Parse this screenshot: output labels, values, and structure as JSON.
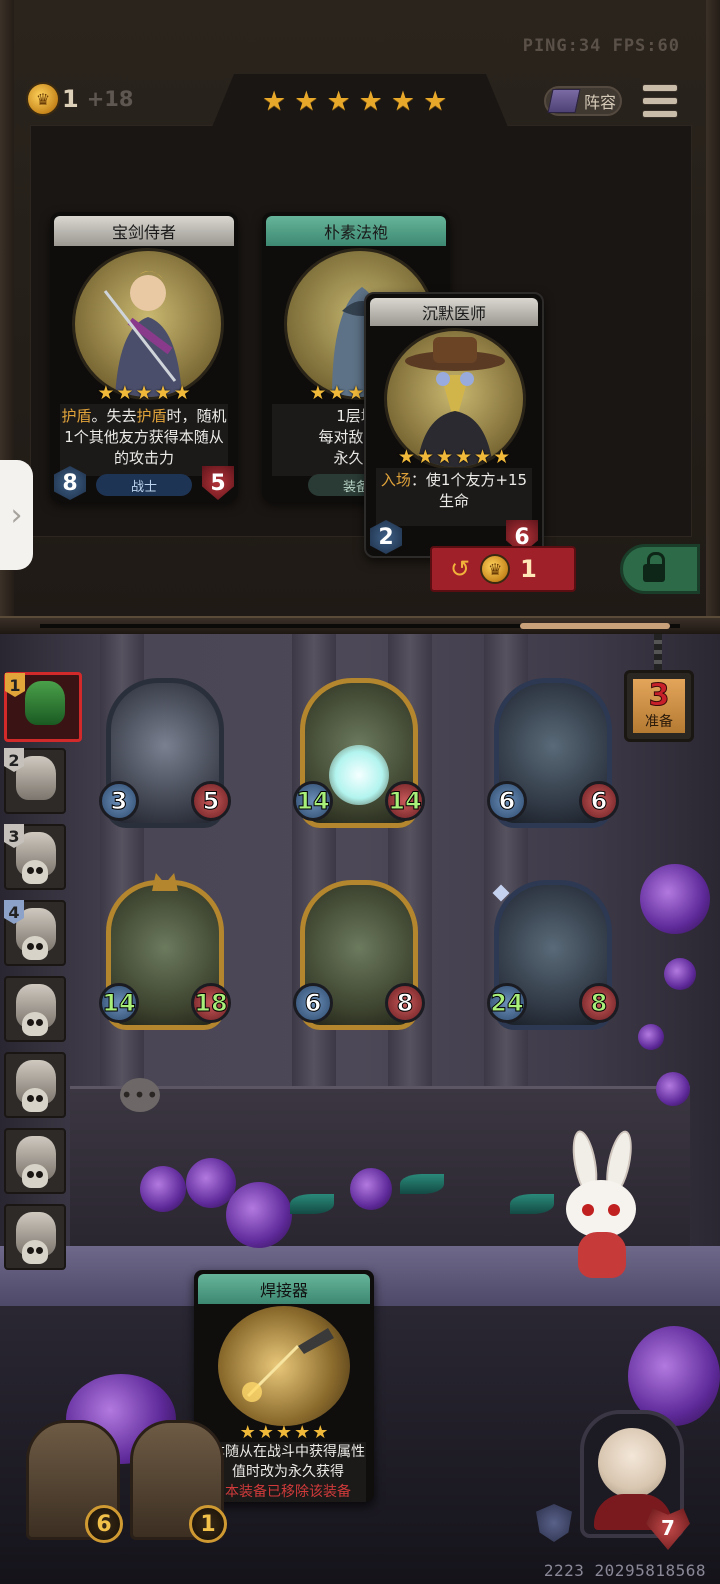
{
  "status": {
    "ping_fps": "PING:34   FPS:60"
  },
  "header": {
    "coins": "1",
    "income": "+18",
    "tier_stars": 6,
    "lineup_label": "阵容",
    "icons": [
      "coin-icon",
      "lineup-book-icon",
      "menu-icon"
    ]
  },
  "shop": {
    "cards": [
      {
        "name": "宝剑侍者",
        "stars": 5,
        "desc_parts": [
          "护盾",
          "。失去",
          "护盾",
          "时，随机1个其他友方获得本随从的攻击力"
        ],
        "attack": "8",
        "health": "5",
        "tag": "战士"
      },
      {
        "name": "朴素法袍",
        "stars": 5,
        "desc_line1": "1层增",
        "desc_line2": "每对敌方造",
        "desc_line3": "永久获",
        "tag": "装备"
      },
      {
        "name": "沉默医师",
        "stars": 6,
        "desc_keyword": "入场",
        "desc_rest": "：使1个友方+15生命",
        "attack": "2",
        "health": "6"
      }
    ],
    "refresh_cost": "1",
    "icons": [
      "refresh-icon",
      "lock-icon",
      "side-expand-icon"
    ]
  },
  "board": {
    "turn_number": "3",
    "turn_label": "准备",
    "minions": [
      {
        "attack": "3",
        "health": "5"
      },
      {
        "attack": "14",
        "health": "14"
      },
      {
        "attack": "6",
        "health": "6"
      },
      {
        "attack": "14",
        "health": "18"
      },
      {
        "attack": "6",
        "health": "8"
      },
      {
        "attack": "24",
        "health": "8"
      }
    ],
    "opponents": [
      {
        "rank": "1"
      },
      {
        "rank": "2"
      },
      {
        "rank": "3"
      },
      {
        "rank": "4"
      },
      {
        "rank": ""
      },
      {
        "rank": ""
      },
      {
        "rank": ""
      },
      {
        "rank": ""
      }
    ],
    "chat_icon": "chat-bubble-icon"
  },
  "hand": {
    "name": "焊接器",
    "stars": 5,
    "desc_normal": "本随从在战斗中获得属性值时改为永久获得",
    "desc_red": "本装备已移除该装备"
  },
  "footer": {
    "chest_left": "6",
    "chest_right": "1",
    "hero_health": "7",
    "user_id": "2223 20295818568"
  },
  "colors": {
    "accent_gold": "#e8a92b",
    "sell_red": "#a0202a",
    "lock_green": "#2c6a48",
    "text_highlight": "#e0a33a"
  }
}
